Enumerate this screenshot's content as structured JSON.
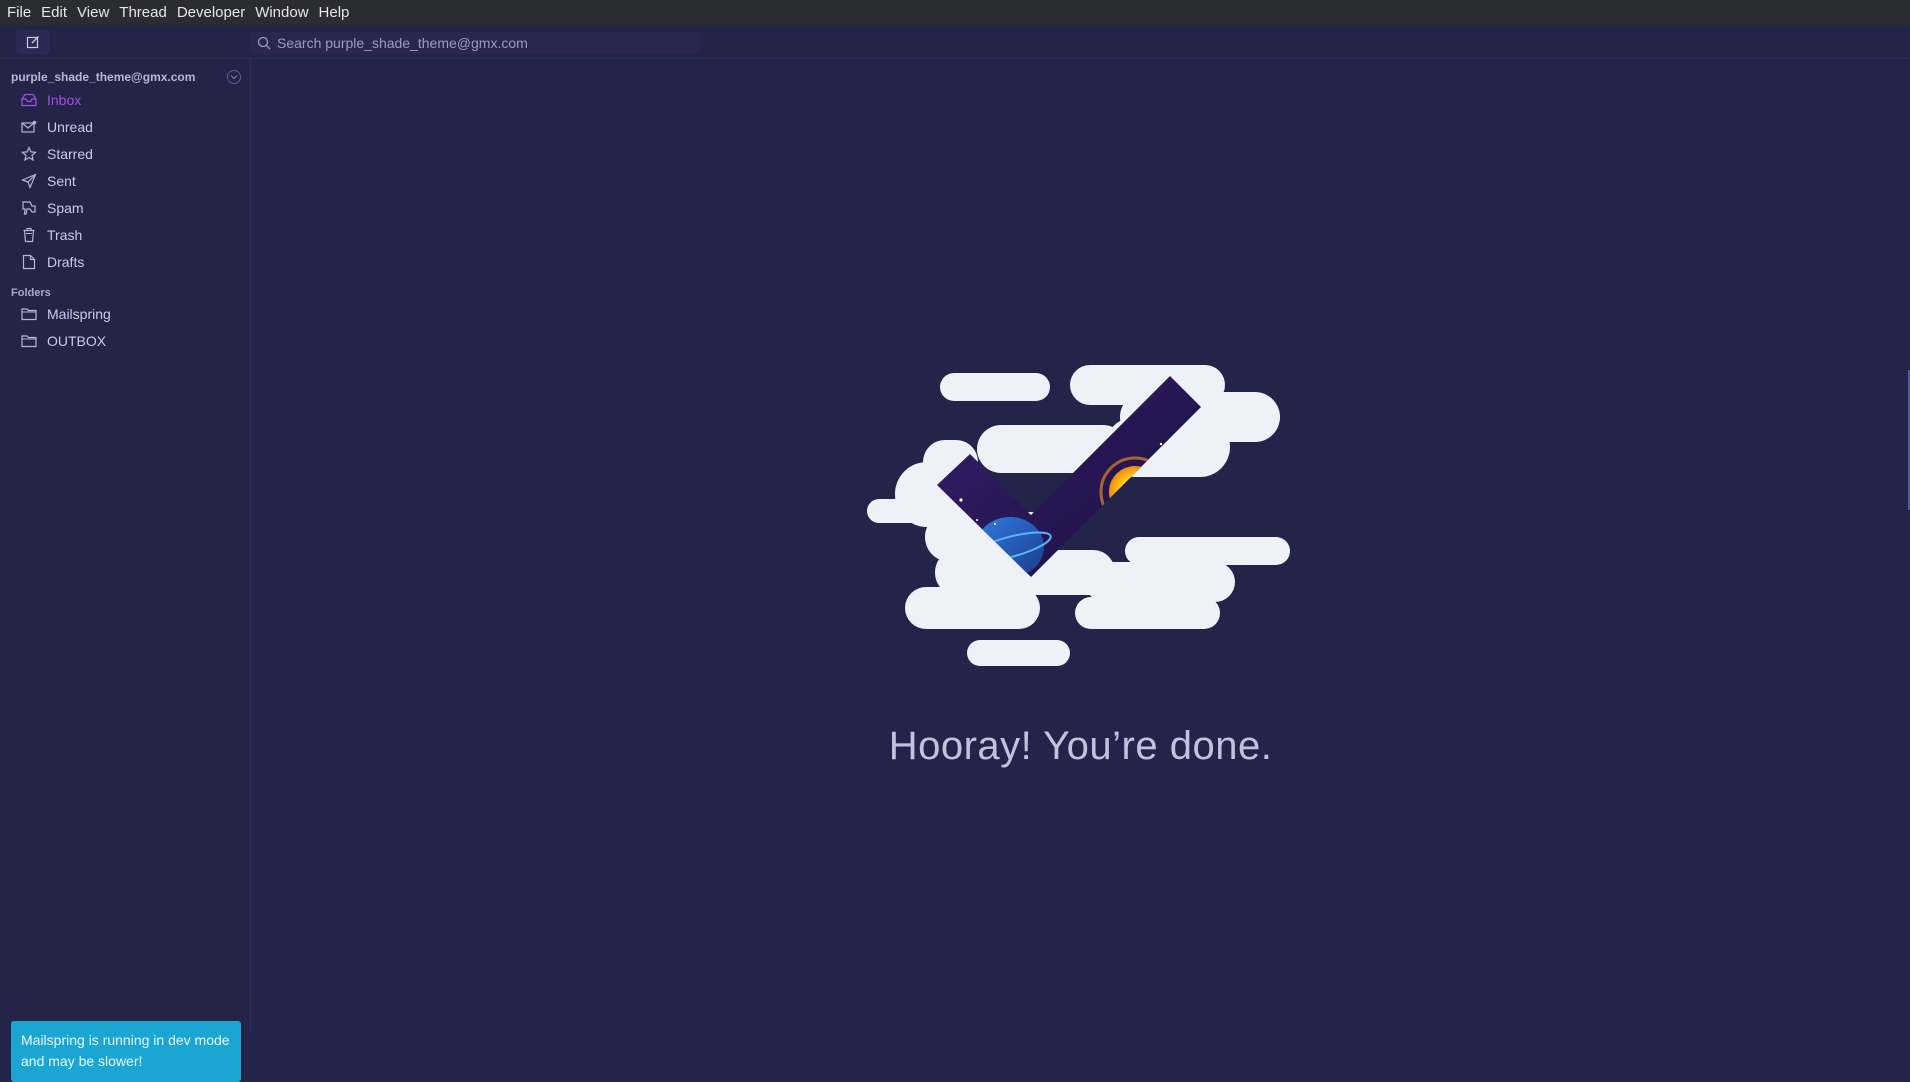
{
  "menubar": {
    "items": [
      "File",
      "Edit",
      "View",
      "Thread",
      "Developer",
      "Window",
      "Help"
    ]
  },
  "toolbar": {
    "compose_icon": "compose-icon",
    "search_placeholder": "Search purple_shade_theme@gmx.com"
  },
  "sidebar": {
    "account": "purple_shade_theme@gmx.com",
    "items": [
      {
        "label": "Inbox",
        "icon": "inbox-icon",
        "active": true
      },
      {
        "label": "Unread",
        "icon": "unread-icon"
      },
      {
        "label": "Starred",
        "icon": "star-icon"
      },
      {
        "label": "Sent",
        "icon": "sent-icon"
      },
      {
        "label": "Spam",
        "icon": "spam-icon"
      },
      {
        "label": "Trash",
        "icon": "trash-icon"
      },
      {
        "label": "Drafts",
        "icon": "drafts-icon"
      }
    ],
    "folders_title": "Folders",
    "folders": [
      {
        "label": "Mailspring",
        "icon": "folder-icon"
      },
      {
        "label": "OUTBOX",
        "icon": "folder-icon"
      }
    ],
    "devmode_notice": "Mailspring is running in dev mode and may be slower!"
  },
  "main": {
    "empty_message": "Hooray! You’re done."
  },
  "colors": {
    "accent": "#a24de6",
    "background": "#23244a",
    "notice": "#1aa5d2"
  }
}
